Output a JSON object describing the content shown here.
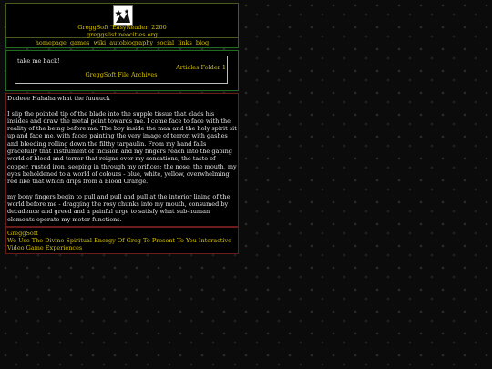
{
  "header": {
    "site_name": "GreggSoft 'EasyReader' 2200",
    "site_url": "greggslist.neocities.org"
  },
  "nav": {
    "items": [
      "homepage",
      "games",
      "wiki",
      "autobiography",
      "social",
      "links",
      "blog"
    ]
  },
  "panel": {
    "back_label": "take me back!",
    "breadcrumb": "Articles Folder 1",
    "archive_title": "GreggSoft File Archives"
  },
  "article": {
    "title": "Dudeee Hahaha what the fuuuuck",
    "paragraphs": [
      "I slip the pointed tip of the blade into the supple tissue that clads his insides and draw the metal point towards me. I come face to face with the reality of the being before me. The boy inside the man and the holy spirit sit up and face me, with faces painting the very image of terror, with gashes and bleeding rolling down the filthy tarpaulin. From my hand falls gracefully that instrument of incision and my fingers reach into the gaping world of blood and terror that reigns over my sensations, the taste of copper, rusted iron, seeping in through my orifices; the nose, the mouth, my eyes beholdened to a world of colours - blue, white, yellow, overwhelming red like that which drips from a Blood Orange.",
      "my bony fingers begin to pull and pull and pull at the interior lining of the world before me - dragging the rosy chunks into my mouth, consumed by decadence and greed and a painful urge to satisfy what sub-human elements operate my motor functions."
    ]
  },
  "footer": {
    "company": "GreggSoft",
    "tagline": "We Use The Divine Spiritual Energy Of Greg To Present To You Interactive Video Game Experiences"
  },
  "colors": {
    "text_yellow": "#d8c200",
    "text_white": "#e6e6e6",
    "border_green": "#1f6b1f",
    "border_red": "#6a1c1c"
  }
}
